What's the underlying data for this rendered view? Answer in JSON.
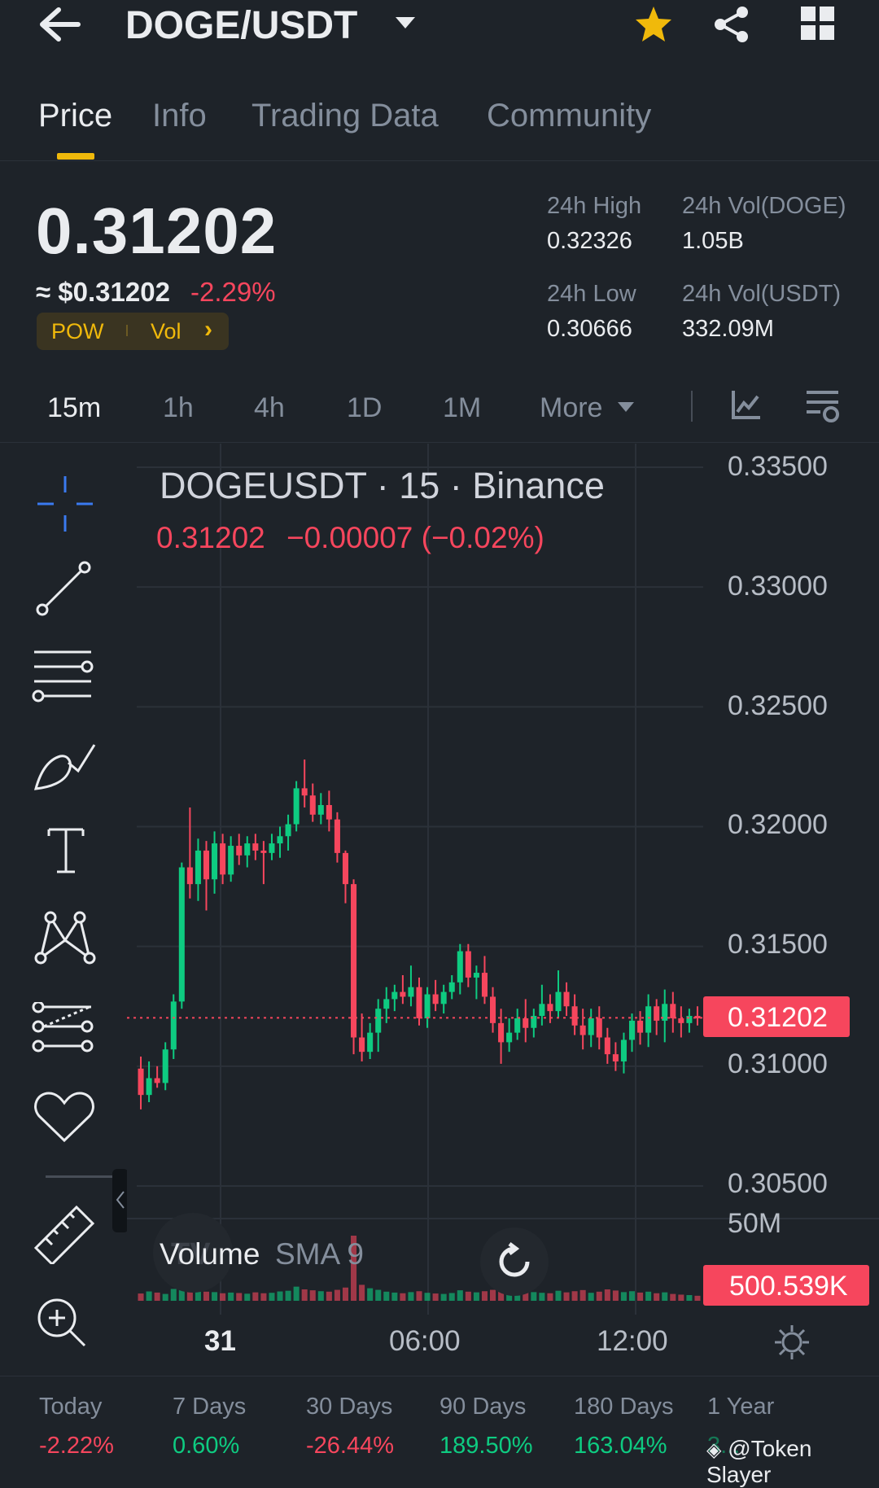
{
  "header": {
    "pair": "DOGE/USDT",
    "back_icon": "arrow-left-icon",
    "dropdown_icon": "caret-down-icon",
    "favorite_icon": "star-icon",
    "share_icon": "share-icon",
    "grid_icon": "grid-icon",
    "favorite_color": "#f0b90b"
  },
  "tabs": [
    {
      "label": "Price",
      "active": true
    },
    {
      "label": "Info",
      "active": false
    },
    {
      "label": "Trading Data",
      "active": false
    },
    {
      "label": "Community",
      "active": false
    }
  ],
  "price": {
    "last": "0.31202",
    "usd": "≈ $0.31202",
    "change": "-2.29%",
    "tag_pow": "POW",
    "tag_vol": "Vol",
    "tag_chevron": "›"
  },
  "stats": {
    "high_label": "24h High",
    "high_value": "0.32326",
    "vol_doge_label": "24h Vol(DOGE)",
    "vol_doge_value": "1.05B",
    "low_label": "24h Low",
    "low_value": "0.30666",
    "vol_usdt_label": "24h Vol(USDT)",
    "vol_usdt_value": "332.09M"
  },
  "intervals": {
    "items": [
      "15m",
      "1h",
      "4h",
      "1D",
      "1M"
    ],
    "active": "15m",
    "more": "More"
  },
  "chart_header": {
    "symbol_line": "DOGEUSDT · 15 · Binance",
    "price": "0.31202",
    "change": "−0.00007 (−0.02%)"
  },
  "drawing_tools": [
    "crosshair-icon",
    "trend-line-icon",
    "horizontal-lines-icon",
    "brush-icon",
    "text-icon",
    "pattern-icon",
    "fib-retracement-icon",
    "heart-icon",
    "ruler-icon",
    "zoom-in-icon"
  ],
  "volume": {
    "label": "Volume",
    "sma": "SMA 9",
    "axis_label": "50M",
    "last_badge": "500.539K"
  },
  "last_price_badge": "0.31202",
  "x_ticks": [
    "31",
    "06:00",
    "12:00"
  ],
  "performance": [
    {
      "label": "Today",
      "value": "-2.22%",
      "dir": "down"
    },
    {
      "label": "7 Days",
      "value": "0.60%",
      "dir": "up"
    },
    {
      "label": "30 Days",
      "value": "-26.44%",
      "dir": "down"
    },
    {
      "label": "90 Days",
      "value": "189.50%",
      "dir": "up"
    },
    {
      "label": "180 Days",
      "value": "163.04%",
      "dir": "up"
    },
    {
      "label": "1 Year",
      "value": "3..."
    }
  ],
  "watermark": "@Token Slayer",
  "colors": {
    "up": "#0ecb81",
    "down": "#f6465d",
    "accent": "#f0b90b",
    "bg": "#1e2329"
  },
  "chart_data": {
    "type": "candlestick",
    "y_ticks": [
      "0.33500",
      "0.33000",
      "0.32500",
      "0.32000",
      "0.31500",
      "0.31000",
      "0.30500"
    ],
    "ylim": [
      0.3035,
      0.3355
    ],
    "x_ticks": [
      "31",
      "06:00",
      "12:00"
    ],
    "candles": [
      [
        0.3099,
        0.3104,
        0.3082,
        0.3088
      ],
      [
        0.3088,
        0.3102,
        0.3085,
        0.3095
      ],
      [
        0.3095,
        0.31,
        0.3091,
        0.3093
      ],
      [
        0.3093,
        0.311,
        0.309,
        0.3107
      ],
      [
        0.3107,
        0.313,
        0.3103,
        0.3127
      ],
      [
        0.3127,
        0.3185,
        0.3124,
        0.3183
      ],
      [
        0.3183,
        0.3208,
        0.317,
        0.3176
      ],
      [
        0.3176,
        0.3195,
        0.3169,
        0.319
      ],
      [
        0.319,
        0.3194,
        0.3165,
        0.3178
      ],
      [
        0.3178,
        0.3198,
        0.3172,
        0.3193
      ],
      [
        0.3193,
        0.3197,
        0.3176,
        0.318
      ],
      [
        0.318,
        0.3196,
        0.3177,
        0.3192
      ],
      [
        0.3192,
        0.3197,
        0.3184,
        0.3188
      ],
      [
        0.3188,
        0.3196,
        0.3183,
        0.3193
      ],
      [
        0.3193,
        0.3197,
        0.3186,
        0.319
      ],
      [
        0.319,
        0.3194,
        0.3176,
        0.3189
      ],
      [
        0.3189,
        0.3197,
        0.3186,
        0.3193
      ],
      [
        0.3193,
        0.32,
        0.3187,
        0.3196
      ],
      [
        0.3196,
        0.3205,
        0.319,
        0.3201
      ],
      [
        0.3201,
        0.3219,
        0.3198,
        0.3216
      ],
      [
        0.3216,
        0.3228,
        0.3208,
        0.3213
      ],
      [
        0.3213,
        0.3218,
        0.3202,
        0.3205
      ],
      [
        0.3205,
        0.3214,
        0.3201,
        0.3209
      ],
      [
        0.3209,
        0.3215,
        0.3198,
        0.3203
      ],
      [
        0.3203,
        0.3206,
        0.3185,
        0.3189
      ],
      [
        0.3189,
        0.319,
        0.3168,
        0.3176
      ],
      [
        0.3176,
        0.3178,
        0.3105,
        0.3112
      ],
      [
        0.3112,
        0.3122,
        0.3102,
        0.3106
      ],
      [
        0.3106,
        0.3118,
        0.3103,
        0.3114
      ],
      [
        0.3114,
        0.3128,
        0.3106,
        0.3124
      ],
      [
        0.3124,
        0.3133,
        0.3118,
        0.3128
      ],
      [
        0.3128,
        0.3134,
        0.3123,
        0.3131
      ],
      [
        0.3131,
        0.3138,
        0.3126,
        0.3129
      ],
      [
        0.3129,
        0.3142,
        0.3125,
        0.3133
      ],
      [
        0.3133,
        0.3137,
        0.3117,
        0.312
      ],
      [
        0.312,
        0.3133,
        0.3116,
        0.313
      ],
      [
        0.313,
        0.3136,
        0.3123,
        0.3126
      ],
      [
        0.3126,
        0.3134,
        0.3122,
        0.3131
      ],
      [
        0.3131,
        0.3138,
        0.3128,
        0.3135
      ],
      [
        0.3135,
        0.3151,
        0.313,
        0.3148
      ],
      [
        0.3148,
        0.3151,
        0.3133,
        0.3137
      ],
      [
        0.3137,
        0.3142,
        0.3128,
        0.3139
      ],
      [
        0.3139,
        0.3146,
        0.3126,
        0.3129
      ],
      [
        0.3129,
        0.3133,
        0.3114,
        0.3118
      ],
      [
        0.3118,
        0.3124,
        0.3101,
        0.311
      ],
      [
        0.311,
        0.312,
        0.3106,
        0.3114
      ],
      [
        0.3114,
        0.3124,
        0.3111,
        0.312
      ],
      [
        0.312,
        0.3128,
        0.311,
        0.3116
      ],
      [
        0.3116,
        0.3124,
        0.3112,
        0.3121
      ],
      [
        0.3121,
        0.3134,
        0.3117,
        0.3126
      ],
      [
        0.3126,
        0.313,
        0.3118,
        0.3123
      ],
      [
        0.3123,
        0.314,
        0.312,
        0.3131
      ],
      [
        0.3131,
        0.3135,
        0.3121,
        0.3125
      ],
      [
        0.3125,
        0.313,
        0.3113,
        0.3117
      ],
      [
        0.3117,
        0.3124,
        0.3107,
        0.3113
      ],
      [
        0.3113,
        0.3124,
        0.3108,
        0.312
      ],
      [
        0.312,
        0.3125,
        0.3107,
        0.3112
      ],
      [
        0.3112,
        0.3116,
        0.3101,
        0.3105
      ],
      [
        0.3105,
        0.311,
        0.3098,
        0.3102
      ],
      [
        0.3102,
        0.3114,
        0.3097,
        0.3111
      ],
      [
        0.3111,
        0.3122,
        0.3106,
        0.3119
      ],
      [
        0.3119,
        0.3123,
        0.3109,
        0.3114
      ],
      [
        0.3114,
        0.313,
        0.3108,
        0.3125
      ],
      [
        0.3125,
        0.3128,
        0.3113,
        0.3119
      ],
      [
        0.3119,
        0.3132,
        0.311,
        0.3126
      ],
      [
        0.3126,
        0.3131,
        0.3114,
        0.312
      ],
      [
        0.312,
        0.3125,
        0.3112,
        0.3118
      ],
      [
        0.3118,
        0.3124,
        0.3114,
        0.3121
      ],
      [
        0.3121,
        0.3125,
        0.3117,
        0.312
      ]
    ],
    "volume": [
      0.32,
      0.41,
      0.36,
      0.3,
      0.52,
      0.78,
      0.55,
      0.47,
      0.4,
      0.38,
      0.33,
      0.36,
      0.34,
      0.31,
      0.37,
      0.33,
      0.35,
      0.41,
      0.44,
      0.62,
      0.5,
      0.46,
      0.42,
      0.4,
      0.48,
      0.58,
      1.0,
      0.7,
      0.55,
      0.48,
      0.4,
      0.36,
      0.33,
      0.38,
      0.42,
      0.35,
      0.32,
      0.3,
      0.34,
      0.46,
      0.4,
      0.37,
      0.42,
      0.48,
      0.55,
      0.4,
      0.36,
      0.41,
      0.38,
      0.35,
      0.33,
      0.44,
      0.37,
      0.42,
      0.47,
      0.35,
      0.4,
      0.5,
      0.45,
      0.38,
      0.42,
      0.36,
      0.4,
      0.33,
      0.37,
      0.3,
      0.27,
      0.25,
      0.22
    ],
    "last_price": 0.31202
  }
}
